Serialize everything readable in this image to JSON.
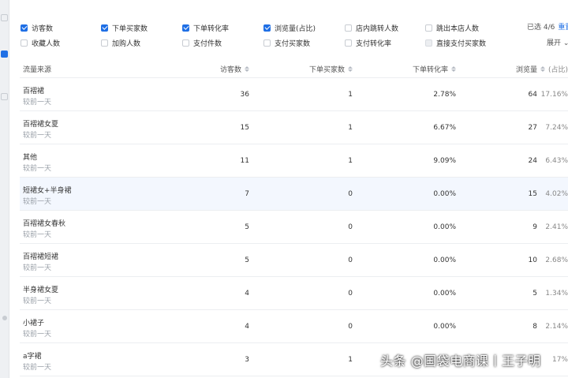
{
  "filters": {
    "row1": [
      {
        "label": "访客数",
        "state": "checked"
      },
      {
        "label": "下单买家数",
        "state": "checked"
      },
      {
        "label": "下单转化率",
        "state": "checked"
      },
      {
        "label": "浏览量(占比)",
        "state": "checked"
      },
      {
        "label": "店内跳转人数",
        "state": "unchecked"
      },
      {
        "label": "跳出本店人数",
        "state": "unchecked"
      }
    ],
    "row2": [
      {
        "label": "收藏人数",
        "state": "unchecked"
      },
      {
        "label": "加购人数",
        "state": "unchecked"
      },
      {
        "label": "支付件数",
        "state": "unchecked"
      },
      {
        "label": "支付买家数",
        "state": "unchecked"
      },
      {
        "label": "支付转化率",
        "state": "unchecked"
      },
      {
        "label": "直接支付买家数",
        "state": "disabled"
      }
    ],
    "selected_text": "已选 4/6",
    "reset_label": "重置",
    "expand_label": "展开 ⌄"
  },
  "table": {
    "headers": {
      "source": "流量来源",
      "visitors": "访客数",
      "buyers": "下单买家数",
      "conversion": "下单转化率",
      "views": "浏览量",
      "share": "(占比)"
    },
    "rows": [
      {
        "source": "百褶裙",
        "compare": "较前一天",
        "visitors": "36",
        "buyers": "1",
        "conversion": "2.78%",
        "views": "64",
        "share": "17.16%"
      },
      {
        "source": "百褶裙女夏",
        "compare": "较前一天",
        "visitors": "15",
        "buyers": "1",
        "conversion": "6.67%",
        "views": "27",
        "share": "7.24%"
      },
      {
        "source": "其他",
        "compare": "较前一天",
        "visitors": "11",
        "buyers": "1",
        "conversion": "9.09%",
        "views": "24",
        "share": "6.43%"
      },
      {
        "source": "短裙女+半身裙",
        "compare": "较前一天",
        "visitors": "7",
        "buyers": "0",
        "conversion": "0.00%",
        "views": "15",
        "share": "4.02%"
      },
      {
        "source": "百褶裙女春秋",
        "compare": "较前一天",
        "visitors": "5",
        "buyers": "0",
        "conversion": "0.00%",
        "views": "9",
        "share": "2.41%"
      },
      {
        "source": "百褶裙短裙",
        "compare": "较前一天",
        "visitors": "5",
        "buyers": "0",
        "conversion": "0.00%",
        "views": "10",
        "share": "2.68%"
      },
      {
        "source": "半身裙女夏",
        "compare": "较前一天",
        "visitors": "4",
        "buyers": "0",
        "conversion": "0.00%",
        "views": "5",
        "share": "1.34%"
      },
      {
        "source": "小裙子",
        "compare": "较前一天",
        "visitors": "4",
        "buyers": "0",
        "conversion": "0.00%",
        "views": "8",
        "share": "2.14%"
      },
      {
        "source": "a字裙",
        "compare": "较前一天",
        "visitors": "3",
        "buyers": "1",
        "conversion": "",
        "views": "",
        "share": "17%"
      }
    ]
  },
  "watermark": "头条 @国袋电商课丨王子明",
  "colors": {
    "accent": "#1f6fe5",
    "highlight_row": "#f3f7fe",
    "muted": "#9aa0a8"
  }
}
